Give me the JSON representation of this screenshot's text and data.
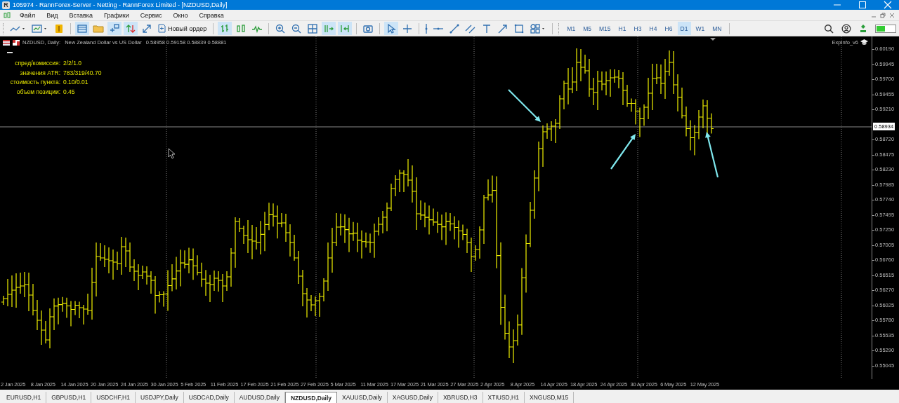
{
  "window": {
    "logo": "R",
    "title": "105974 - RannForex-Server - Netting - RannForex Limited - [NZDUSD,Daily]"
  },
  "menu": [
    "Файл",
    "Вид",
    "Вставка",
    "Графики",
    "Сервис",
    "Окно",
    "Справка"
  ],
  "toolbar": {
    "tools": [
      {
        "kind": "icon",
        "selected": false
      },
      {
        "kind": "icon",
        "selected": false
      },
      {
        "kind": "icon",
        "selected": false
      },
      {
        "kind": "separator"
      },
      {
        "kind": "icon",
        "selected": true
      },
      {
        "kind": "icon",
        "selected": false
      },
      {
        "kind": "icon",
        "selected": true
      },
      {
        "kind": "icon",
        "selected": true
      },
      {
        "kind": "icon",
        "selected": false
      },
      {
        "kind": "button",
        "label": "Новый ордер"
      },
      {
        "kind": "separator"
      },
      {
        "kind": "icon",
        "selected": true
      },
      {
        "kind": "icon",
        "selected": false
      },
      {
        "kind": "icon",
        "selected": false
      },
      {
        "kind": "separator"
      },
      {
        "kind": "icon",
        "selected": false
      },
      {
        "kind": "icon",
        "selected": false
      },
      {
        "kind": "icon",
        "selected": false
      },
      {
        "kind": "icon",
        "selected": true
      },
      {
        "kind": "icon",
        "selected": true
      },
      {
        "kind": "separator"
      },
      {
        "kind": "icon",
        "selected": false
      },
      {
        "kind": "separator"
      },
      {
        "kind": "icon",
        "selected": true
      },
      {
        "kind": "icon",
        "selected": false
      },
      {
        "kind": "separator"
      },
      {
        "kind": "icon",
        "selected": false
      },
      {
        "kind": "icon",
        "selected": false
      },
      {
        "kind": "icon",
        "selected": false
      },
      {
        "kind": "icon",
        "selected": false
      },
      {
        "kind": "icon",
        "selected": false
      },
      {
        "kind": "icon",
        "selected": false
      },
      {
        "kind": "icon",
        "selected": false
      },
      {
        "kind": "icon",
        "selected": false
      },
      {
        "kind": "separator"
      }
    ]
  },
  "timeframes": [
    {
      "label": "M1",
      "selected": false
    },
    {
      "label": "M5",
      "selected": false
    },
    {
      "label": "M15",
      "selected": false
    },
    {
      "label": "H1",
      "selected": false
    },
    {
      "label": "H3",
      "selected": false
    },
    {
      "label": "H4",
      "selected": false
    },
    {
      "label": "H6",
      "selected": false
    },
    {
      "label": "D1",
      "selected": true
    },
    {
      "label": "W1",
      "selected": false
    },
    {
      "label": "MN",
      "selected": false
    }
  ],
  "chart": {
    "header": {
      "symbol": "NZDUSD, Daily:",
      "description": "New Zealand Dollar vs US Dollar",
      "prices": "0.58958 0.59158 0.58839 0.58881"
    },
    "indicator": "ExpInfo_v6",
    "info": [
      {
        "label": "спред/комиссия:",
        "value": "2/2/1.0"
      },
      {
        "label": "значения ATR:",
        "value": "783/319/40.70"
      },
      {
        "label": "стоимость пункта:",
        "value": "0.10/0.01"
      },
      {
        "label": "объем позиции:",
        "value": "0.45"
      }
    ],
    "current_price": "0.58934",
    "price_labels": [
      "0.60190",
      "0.59945",
      "0.59700",
      "0.59455",
      "0.59210",
      "0.58720",
      "0.58475",
      "0.58230",
      "0.57985",
      "0.57740",
      "0.57495",
      "0.57250",
      "0.57005",
      "0.56760",
      "0.56515",
      "0.56270",
      "0.56025",
      "0.55780",
      "0.55535",
      "0.55290",
      "0.55045"
    ],
    "date_labels": [
      "2 Jan 2025",
      "8 Jan 2025",
      "14 Jan 2025",
      "20 Jan 2025",
      "24 Jan 2025",
      "30 Jan 2025",
      "5 Feb 2025",
      "11 Feb 2025",
      "17 Feb 2025",
      "21 Feb 2025",
      "27 Feb 2025",
      "5 Mar 2025",
      "11 Mar 2025",
      "17 Mar 2025",
      "21 Mar 2025",
      "27 Mar 2025",
      "2 Apr 2025",
      "8 Apr 2025",
      "14 Apr 2025",
      "18 Apr 2025",
      "24 Apr 2025",
      "30 Apr 2025",
      "6 May 2025",
      "12 May 2025"
    ]
  },
  "tabs": [
    {
      "label": "EURUSD,H1",
      "selected": false
    },
    {
      "label": "GBPUSD,H1",
      "selected": false
    },
    {
      "label": "USDCHF,H1",
      "selected": false
    },
    {
      "label": "USDJPY,Daily",
      "selected": false
    },
    {
      "label": "USDCAD,Daily",
      "selected": false
    },
    {
      "label": "AUDUSD,Daily",
      "selected": false
    },
    {
      "label": "NZDUSD,Daily",
      "selected": true
    },
    {
      "label": "XAUUSD,Daily",
      "selected": false
    },
    {
      "label": "XAGUSD,Daily",
      "selected": false
    },
    {
      "label": "XBRUSD,H3",
      "selected": false
    },
    {
      "label": "XTIUSD,H1",
      "selected": false
    },
    {
      "label": "XNGUSD,M15",
      "selected": false
    }
  ]
}
